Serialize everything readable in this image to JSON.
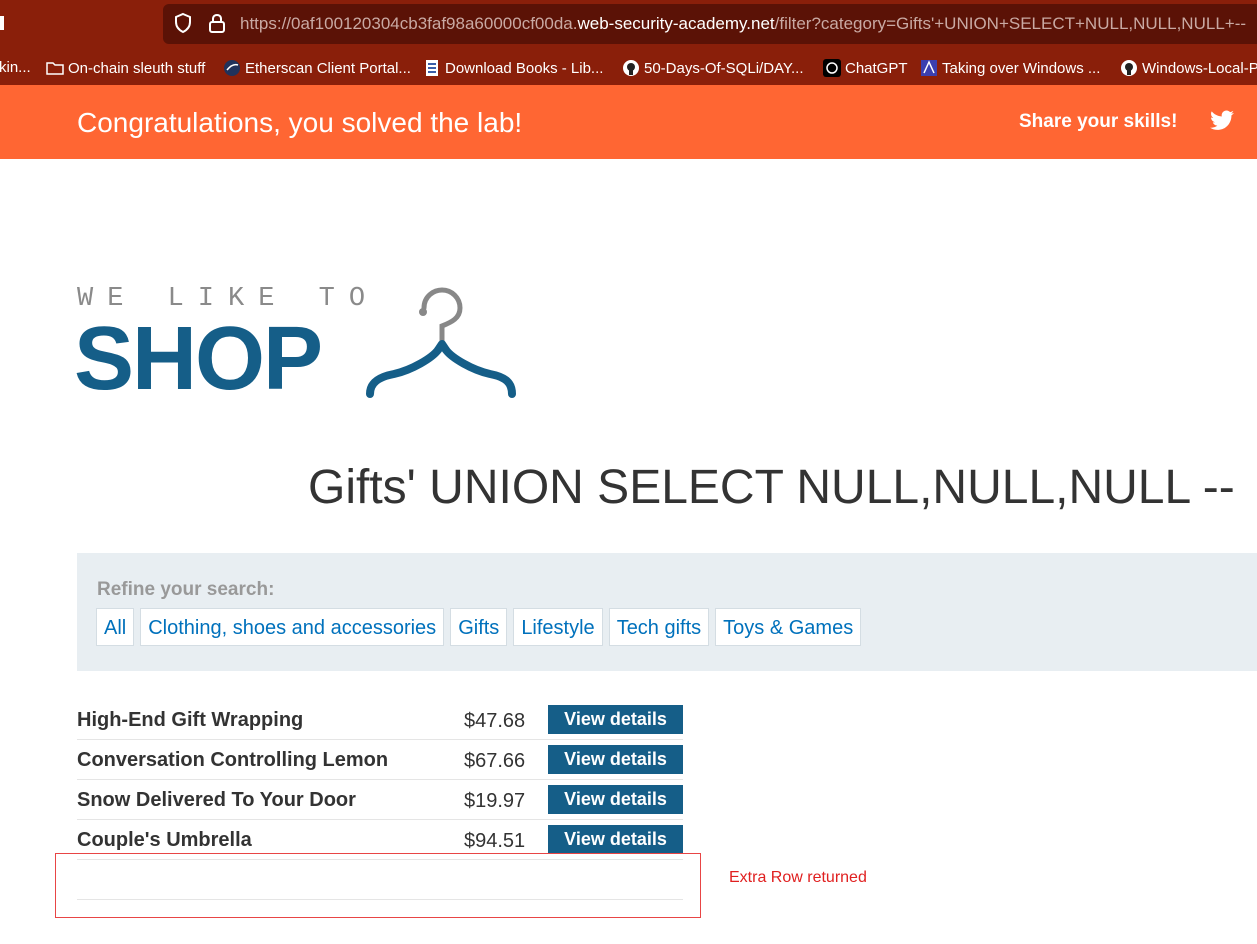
{
  "browser": {
    "url_prefix": "https://0af100120304cb3faf98a60000cf00da.",
    "url_host": "web-security-academy.net",
    "url_path": "/filter?category=Gifts'+UNION+SELECT+NULL,NULL,NULL+--",
    "icons": [
      "shield-icon",
      "lock-icon"
    ]
  },
  "bookmarks": [
    {
      "label": "kin...",
      "icon": ""
    },
    {
      "label": "On-chain sleuth stuff",
      "icon": "folder-icon"
    },
    {
      "label": "Etherscan Client Portal...",
      "icon": "etherscan-icon"
    },
    {
      "label": "Download Books - Lib...",
      "icon": "book-icon"
    },
    {
      "label": "50-Days-Of-SQLi/DAY...",
      "icon": "github-icon"
    },
    {
      "label": "ChatGPT",
      "icon": "chatgpt-icon"
    },
    {
      "label": "Taking over Windows ...",
      "icon": "site-icon"
    },
    {
      "label": "Windows-Local-P",
      "icon": "github-icon"
    }
  ],
  "banner": {
    "title": "Congratulations, you solved the lab!",
    "share": "Share your skills!",
    "icon": "twitter-icon",
    "color": "#ff6633"
  },
  "logo": {
    "top": "WE LIKE TO",
    "main": "SHOP"
  },
  "heading": "Gifts' UNION SELECT NULL,NULL,NULL --",
  "filter": {
    "label": "Refine your search:",
    "links": [
      "All",
      "Clothing, shoes and accessories",
      "Gifts",
      "Lifestyle",
      "Tech gifts",
      "Toys & Games"
    ]
  },
  "products": [
    {
      "name": "High-End Gift Wrapping",
      "price": "$47.68",
      "button": "View details"
    },
    {
      "name": "Conversation Controlling Lemon",
      "price": "$67.66",
      "button": "View details"
    },
    {
      "name": "Snow Delivered To Your Door",
      "price": "$19.97",
      "button": "View details"
    },
    {
      "name": "Couple's Umbrella",
      "price": "$94.51",
      "button": "View details"
    }
  ],
  "annotation": "Extra Row returned",
  "colors": {
    "brand_blue": "#155e88",
    "link_blue": "#0071bc",
    "browser_bg": "#8a1f0a"
  }
}
